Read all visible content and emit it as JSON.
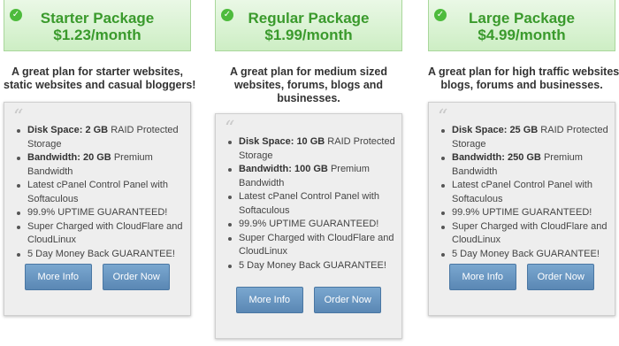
{
  "colors": {
    "header_text": "#3a9a2c",
    "header_bg": "#d8f3d0",
    "button_bg": "#6a97c2",
    "card_bg": "#eeeeee"
  },
  "packages": [
    {
      "name": "Starter Package",
      "price": "$1.23/month",
      "desc_lines": [
        "A great plan for starter websites,",
        "static websites and casual bloggers!"
      ],
      "features": [
        {
          "label": "Disk Space:",
          "value": "2 GB",
          "rest": "RAID Protected Storage"
        },
        {
          "label": "Bandwidth:",
          "value": "20 GB",
          "rest": "Premium Bandwidth"
        },
        {
          "label": "",
          "value": "",
          "rest": "Latest cPanel Control Panel with Softaculous"
        },
        {
          "label": "",
          "value": "",
          "rest": "99.9% UPTIME GUARANTEED!"
        },
        {
          "label": "",
          "value": "",
          "rest": "Super Charged with CloudFlare and CloudLinux"
        },
        {
          "label": "",
          "value": "",
          "rest": "5 Day Money Back GUARANTEE!"
        }
      ],
      "more_info": "More Info",
      "order_now": "Order Now"
    },
    {
      "name": "Regular Package",
      "price": "$1.99/month",
      "desc_lines": [
        "A great plan for medium sized",
        "websites, forums, blogs and",
        "businesses."
      ],
      "features": [
        {
          "label": "Disk Space:",
          "value": "10 GB",
          "rest": "RAID Protected Storage"
        },
        {
          "label": "Bandwidth:",
          "value": "100 GB",
          "rest": "Premium Bandwidth"
        },
        {
          "label": "",
          "value": "",
          "rest": "Latest cPanel Control Panel with Softaculous"
        },
        {
          "label": "",
          "value": "",
          "rest": "99.9% UPTIME GUARANTEED!"
        },
        {
          "label": "",
          "value": "",
          "rest": "Super Charged with CloudFlare and CloudLinux"
        },
        {
          "label": "",
          "value": "",
          "rest": "5 Day Money Back GUARANTEE!"
        }
      ],
      "more_info": "More Info",
      "order_now": "Order Now"
    },
    {
      "name": "Large Package",
      "price": "$4.99/month",
      "desc_lines": [
        "A great plan for high traffic websites,",
        "blogs, forums and businesses."
      ],
      "features": [
        {
          "label": "Disk Space:",
          "value": "25 GB",
          "rest": "RAID Protected Storage"
        },
        {
          "label": "Bandwidth:",
          "value": "250 GB",
          "rest": "Premium Bandwidth"
        },
        {
          "label": "",
          "value": "",
          "rest": "Latest cPanel Control Panel with Softaculous"
        },
        {
          "label": "",
          "value": "",
          "rest": "99.9% UPTIME GUARANTEED!"
        },
        {
          "label": "",
          "value": "",
          "rest": "Super Charged with CloudFlare and CloudLinux"
        },
        {
          "label": "",
          "value": "",
          "rest": "5 Day Money Back GUARANTEE!"
        }
      ],
      "more_info": "More Info",
      "order_now": "Order Now"
    }
  ]
}
